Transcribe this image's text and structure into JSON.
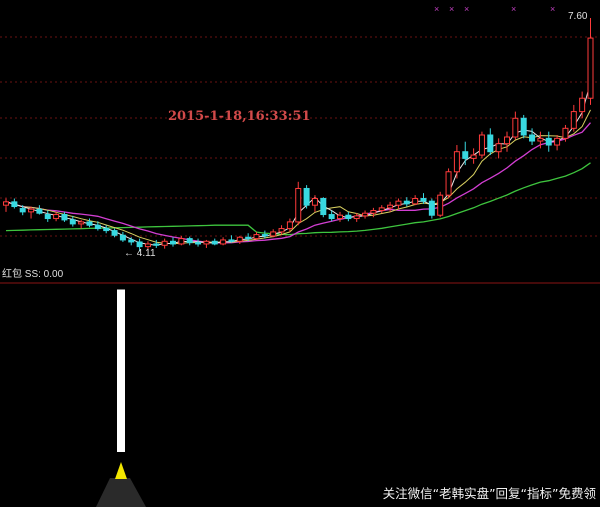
{
  "chart_data": {
    "type": "candlestick",
    "timestamp": "2015-1-18,16:33:51",
    "high_price_label": "7.60",
    "low_price_label": "4.11",
    "ylim": [
      3.95,
      7.75
    ],
    "candles": [
      [
        4.8,
        4.9,
        4.7,
        4.85
      ],
      [
        4.85,
        4.9,
        4.75,
        4.78
      ],
      [
        4.75,
        4.8,
        4.65,
        4.7
      ],
      [
        4.7,
        4.78,
        4.6,
        4.74
      ],
      [
        4.74,
        4.8,
        4.66,
        4.68
      ],
      [
        4.66,
        4.72,
        4.55,
        4.6
      ],
      [
        4.6,
        4.7,
        4.56,
        4.66
      ],
      [
        4.66,
        4.7,
        4.55,
        4.58
      ],
      [
        4.58,
        4.64,
        4.48,
        4.52
      ],
      [
        4.52,
        4.58,
        4.45,
        4.55
      ],
      [
        4.55,
        4.6,
        4.47,
        4.5
      ],
      [
        4.5,
        4.56,
        4.42,
        4.45
      ],
      [
        4.45,
        4.5,
        4.38,
        4.42
      ],
      [
        4.42,
        4.45,
        4.32,
        4.35
      ],
      [
        4.35,
        4.4,
        4.25,
        4.28
      ],
      [
        4.28,
        4.32,
        4.2,
        4.25
      ],
      [
        4.25,
        4.3,
        4.11,
        4.18
      ],
      [
        4.18,
        4.26,
        4.12,
        4.22
      ],
      [
        4.22,
        4.28,
        4.16,
        4.2
      ],
      [
        4.2,
        4.3,
        4.15,
        4.26
      ],
      [
        4.26,
        4.32,
        4.18,
        4.22
      ],
      [
        4.22,
        4.34,
        4.2,
        4.3
      ],
      [
        4.3,
        4.33,
        4.2,
        4.24
      ],
      [
        4.24,
        4.3,
        4.18,
        4.22
      ],
      [
        4.22,
        4.28,
        4.16,
        4.26
      ],
      [
        4.26,
        4.3,
        4.2,
        4.22
      ],
      [
        4.22,
        4.32,
        4.2,
        4.28
      ],
      [
        4.28,
        4.35,
        4.24,
        4.26
      ],
      [
        4.26,
        4.34,
        4.22,
        4.32
      ],
      [
        4.32,
        4.38,
        4.26,
        4.3
      ],
      [
        4.3,
        4.4,
        4.28,
        4.36
      ],
      [
        4.36,
        4.42,
        4.3,
        4.34
      ],
      [
        4.34,
        4.44,
        4.32,
        4.4
      ],
      [
        4.4,
        4.5,
        4.36,
        4.45
      ],
      [
        4.45,
        4.6,
        4.4,
        4.55
      ],
      [
        4.55,
        5.15,
        4.5,
        5.05
      ],
      [
        5.05,
        5.1,
        4.75,
        4.8
      ],
      [
        4.8,
        4.95,
        4.7,
        4.9
      ],
      [
        4.9,
        4.92,
        4.62,
        4.66
      ],
      [
        4.66,
        4.72,
        4.56,
        4.6
      ],
      [
        4.6,
        4.7,
        4.55,
        4.65
      ],
      [
        4.65,
        4.7,
        4.56,
        4.6
      ],
      [
        4.6,
        4.68,
        4.55,
        4.64
      ],
      [
        4.64,
        4.72,
        4.6,
        4.68
      ],
      [
        4.68,
        4.76,
        4.62,
        4.72
      ],
      [
        4.72,
        4.8,
        4.68,
        4.76
      ],
      [
        4.76,
        4.85,
        4.7,
        4.8
      ],
      [
        4.8,
        4.9,
        4.74,
        4.86
      ],
      [
        4.86,
        4.92,
        4.78,
        4.82
      ],
      [
        4.82,
        4.95,
        4.8,
        4.9
      ],
      [
        4.9,
        4.98,
        4.82,
        4.86
      ],
      [
        4.86,
        4.9,
        4.6,
        4.65
      ],
      [
        4.65,
        5.0,
        4.62,
        4.95
      ],
      [
        4.95,
        5.35,
        4.9,
        5.3
      ],
      [
        5.3,
        5.7,
        5.2,
        5.6
      ],
      [
        5.6,
        5.75,
        5.4,
        5.5
      ],
      [
        5.5,
        5.65,
        5.42,
        5.55
      ],
      [
        5.55,
        5.9,
        5.5,
        5.85
      ],
      [
        5.85,
        5.95,
        5.55,
        5.6
      ],
      [
        5.6,
        5.8,
        5.5,
        5.72
      ],
      [
        5.72,
        5.9,
        5.6,
        5.82
      ],
      [
        5.82,
        6.2,
        5.78,
        6.1
      ],
      [
        6.1,
        6.15,
        5.8,
        5.85
      ],
      [
        5.85,
        5.95,
        5.7,
        5.76
      ],
      [
        5.76,
        5.9,
        5.65,
        5.8
      ],
      [
        5.8,
        5.9,
        5.6,
        5.7
      ],
      [
        5.7,
        5.85,
        5.62,
        5.8
      ],
      [
        5.8,
        6.0,
        5.75,
        5.95
      ],
      [
        5.95,
        6.3,
        5.9,
        6.2
      ],
      [
        6.2,
        6.5,
        6.1,
        6.4
      ],
      [
        6.4,
        7.6,
        6.3,
        7.3
      ]
    ]
  },
  "indicator": {
    "label": "红包 SS: 0.00",
    "signal_ratio": 0.98
  },
  "watermark": "关注微信“老韩实盘”回复“指标”免费领"
}
